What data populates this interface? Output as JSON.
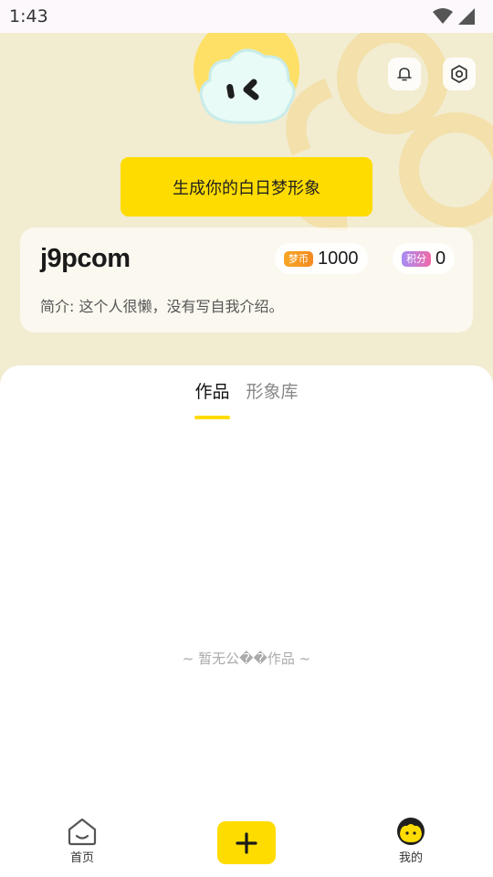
{
  "status_bar": {
    "time": "1:43",
    "wifi_icon": "wifi-icon",
    "signal_icon": "signal-icon"
  },
  "header": {
    "bell_icon": "bell-icon",
    "settings_icon": "settings-icon",
    "generate_button": "生成你的白日梦形象"
  },
  "profile": {
    "username": "j9pcom",
    "coin_tag": "梦币",
    "coin_value": "1000",
    "points_tag": "积分",
    "points_value": "0",
    "bio": "简介: 这个人很懒，没有写自我介绍。"
  },
  "tabs": [
    {
      "label": "作品",
      "active": true
    },
    {
      "label": "形象库",
      "active": false
    }
  ],
  "empty_text": "~ 暂无公��作品 ~",
  "bottom_nav": {
    "home_label": "首页",
    "add_icon": "plus-icon",
    "mine_label": "我的"
  },
  "colors": {
    "accent": "#ffdc00",
    "header_bg": "#f2ecd1"
  }
}
